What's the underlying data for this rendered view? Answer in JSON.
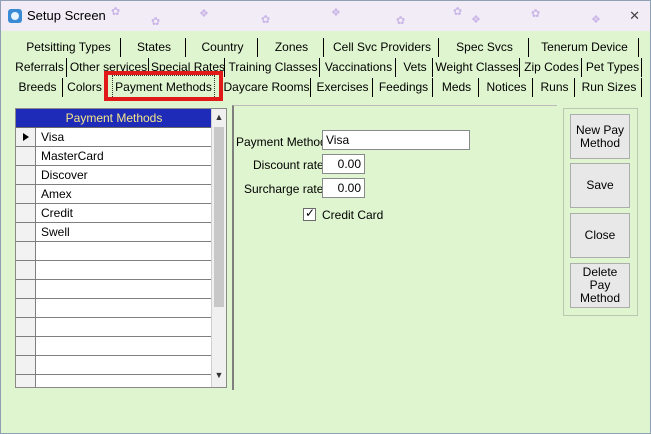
{
  "window": {
    "title": "Setup Screen",
    "close_glyph": "✕",
    "icon": "app-icon"
  },
  "tabs": {
    "row1": [
      "Petsitting Types",
      "States",
      "Country",
      "Zones",
      "Cell Svc Providers",
      "Spec Svcs",
      "Tenerum Device"
    ],
    "row2": [
      "Referrals",
      "Other services",
      "Special Rates",
      "Training Classes",
      "Vaccinations",
      "Vets",
      "Weight Classes",
      "Zip Codes",
      "Pet Types"
    ],
    "row3": [
      "Breeds",
      "Colors",
      "Payment Methods",
      "Daycare Rooms",
      "Exercises",
      "Feedings",
      "Meds",
      "Notices",
      "Runs",
      "Run Sizes"
    ],
    "active": "Payment Methods",
    "highlight_color": "#e11919"
  },
  "grid": {
    "header": "Payment Methods",
    "rows": [
      "Visa",
      "MasterCard",
      "Discover",
      "Amex",
      "Credit",
      "Swell",
      "",
      "",
      "",
      "",
      "",
      "",
      "",
      ""
    ],
    "selected_index": 0,
    "header_bg": "#1e2bb8",
    "header_fg": "#f5e68a"
  },
  "detail": {
    "payment_method_label": "Payment Method",
    "payment_method_value": "Visa",
    "discount_label": "Discount rate:",
    "discount_value": "0.00",
    "surcharge_label": "Surcharge rate:",
    "surcharge_value": "0.00",
    "credit_card_label": "Credit Card",
    "credit_card_checked": true
  },
  "buttons": {
    "new": "New Pay Method",
    "save": "Save",
    "close": "Close",
    "delete": "Delete Pay Method"
  },
  "colors": {
    "background": "#dff5cf",
    "titlebar": "#f1ecf6"
  }
}
